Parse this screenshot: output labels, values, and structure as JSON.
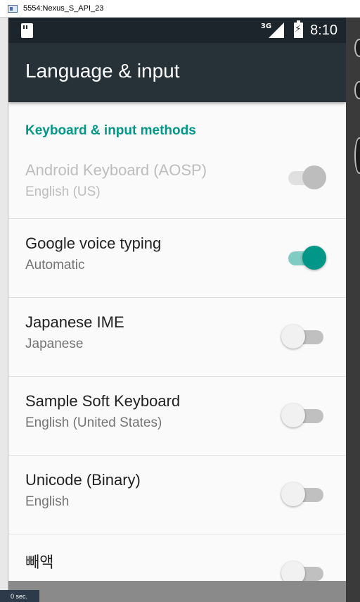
{
  "window": {
    "title": "5554:Nexus_S_API_23"
  },
  "host": {
    "bottom_label": "0 sec."
  },
  "statusbar": {
    "network_type": "3G",
    "time": "8:10"
  },
  "appbar": {
    "title": "Language & input"
  },
  "section": {
    "header": "Keyboard & input methods"
  },
  "items": [
    {
      "title": "Android Keyboard (AOSP)",
      "subtitle": "English (US)",
      "state": "on",
      "enabled": false
    },
    {
      "title": "Google voice typing",
      "subtitle": "Automatic",
      "state": "on",
      "enabled": true
    },
    {
      "title": "Japanese IME",
      "subtitle": "Japanese",
      "state": "off",
      "enabled": true
    },
    {
      "title": "Sample Soft Keyboard",
      "subtitle": "English (United States)",
      "state": "off",
      "enabled": true
    },
    {
      "title": "Unicode (Binary)",
      "subtitle": "English",
      "state": "off",
      "enabled": true
    },
    {
      "title": "빼액",
      "subtitle": "",
      "state": "off",
      "enabled": true
    }
  ],
  "colors": {
    "accent": "#009688",
    "appbar": "#263238",
    "statusbar": "#1b252b",
    "background": "#fafafa"
  },
  "icons": {
    "sd_card": "sd-card-icon",
    "signal": "signal-icon",
    "battery": "battery-charging-icon"
  }
}
